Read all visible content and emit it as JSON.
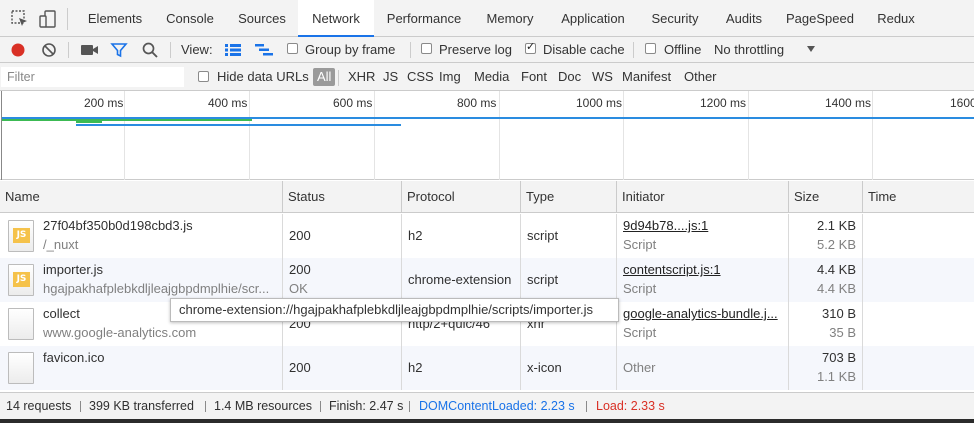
{
  "tabs": [
    {
      "label": "Elements"
    },
    {
      "label": "Console"
    },
    {
      "label": "Sources"
    },
    {
      "label": "Network"
    },
    {
      "label": "Performance"
    },
    {
      "label": "Memory"
    },
    {
      "label": "Application"
    },
    {
      "label": "Security"
    },
    {
      "label": "Audits"
    },
    {
      "label": "PageSpeed"
    },
    {
      "label": "Redux"
    }
  ],
  "active_tab": "Network",
  "toolbar": {
    "view_label": "View:",
    "group_by_frame": "Group by frame",
    "preserve_log": "Preserve log",
    "disable_cache": "Disable cache",
    "offline": "Offline",
    "throttling": "No throttling",
    "group_by_frame_checked": false,
    "preserve_log_checked": false,
    "disable_cache_checked": true,
    "offline_checked": false
  },
  "filterbar": {
    "placeholder": "Filter",
    "hide_data_urls": "Hide data URLs",
    "types": [
      "All",
      "XHR",
      "JS",
      "CSS",
      "Img",
      "Media",
      "Font",
      "Doc",
      "WS",
      "Manifest",
      "Other"
    ]
  },
  "overview": {
    "ticks": [
      "200 ms",
      "400 ms",
      "600 ms",
      "800 ms",
      "1000 ms",
      "1200 ms",
      "1400 ms",
      "1600"
    ]
  },
  "columns": [
    "Name",
    "Status",
    "Protocol",
    "Type",
    "Initiator",
    "Size",
    "Time"
  ],
  "rows": [
    {
      "name": "27f04bf350b0d198cbd3.js",
      "path": "/_nuxt",
      "status": "200",
      "status_text": "",
      "protocol": "h2",
      "type": "script",
      "initiator": "9d94b78....js:1",
      "initiator_sub": "Script",
      "size": "2.1 KB",
      "size_sub": "5.2 KB",
      "icon": "js-file-icon"
    },
    {
      "name": "importer.js",
      "path": "hgajpakhafplebkdljleajgbpdmplhie/scr...",
      "status": "200",
      "status_text": "OK",
      "protocol": "chrome-extension",
      "type": "script",
      "initiator": "contentscript.js:1",
      "initiator_sub": "Script",
      "size": "4.4 KB",
      "size_sub": "4.4 KB",
      "icon": "js-file-icon"
    },
    {
      "name": "collect",
      "path": "www.google-analytics.com",
      "status": "200",
      "status_text": "",
      "protocol": "http/2+quic/46",
      "type": "xhr",
      "initiator": "google-analytics-bundle.j...",
      "initiator_sub": "Script",
      "size": "310 B",
      "size_sub": "35 B",
      "icon": "blank-file-icon"
    },
    {
      "name": "favicon.ico",
      "path": "",
      "status": "200",
      "status_text": "",
      "protocol": "h2",
      "type": "x-icon",
      "initiator": "Other",
      "initiator_sub": "",
      "size": "703 B",
      "size_sub": "1.1 KB",
      "icon": "blank-file-icon"
    }
  ],
  "tooltip": "chrome-extension://hgajpakhafplebkdljleajgbpdmplhie/scripts/importer.js",
  "status": {
    "requests": "14 requests",
    "transferred": "399 KB transferred",
    "resources": "1.4 MB resources",
    "finish": "Finish: 2.47 s",
    "dom_content_loaded": "DOMContentLoaded: 2.23 s",
    "load": "Load: 2.33 s"
  },
  "colors": {
    "accent": "#1a73e8",
    "record": "#d93025",
    "dcl": "#1a73e8",
    "load": "#d93025",
    "bar_green": "#3cba54",
    "bar_blue": "#2a8ce0"
  }
}
